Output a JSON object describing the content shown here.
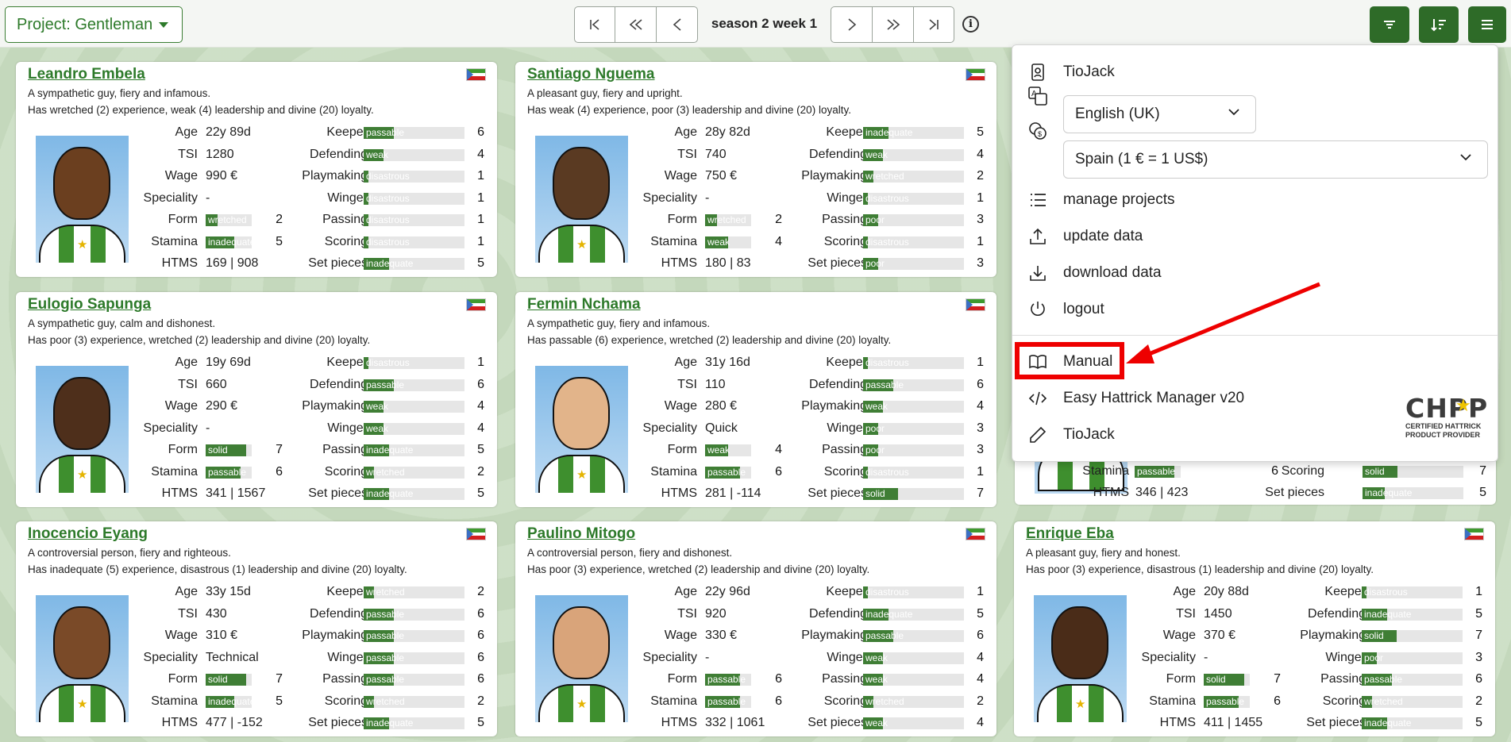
{
  "topbar": {
    "project_label": "Project: Gentleman",
    "season": "season 2 week 1",
    "info": "i"
  },
  "menu": {
    "user": "TioJack",
    "language": "English (UK)",
    "currency": "Spain (1 € = 1 US$)",
    "items": [
      "manage projects",
      "update data",
      "download data",
      "logout"
    ],
    "manual": "Manual",
    "app": "Easy Hattrick Manager v20",
    "author": "TioJack",
    "chpp_line1": "CERTIFIED HATTRICK",
    "chpp_line2": "PRODUCT PROVIDER",
    "chpp_logo": "CHPP"
  },
  "labels": {
    "age": "Age",
    "tsi": "TSI",
    "wage": "Wage",
    "speciality": "Speciality",
    "form": "Form",
    "stamina": "Stamina",
    "htms": "HTMS",
    "keeper": "Keeper",
    "defending": "Defending",
    "playmaking": "Playmaking",
    "winger": "Winger",
    "passing": "Passing",
    "scoring": "Scoring",
    "set_pieces": "Set pieces"
  },
  "players": [
    {
      "name": "Leandro Embela",
      "d1": "A sympathetic guy, fiery and infamous.",
      "d2": "Has wretched (2) experience, weak (4) leadership and divine (20) loyalty.",
      "age": "22y 89d",
      "tsi": "1280",
      "wage": "990 €",
      "spec": "-",
      "form": [
        "wretched",
        2
      ],
      "stamina": [
        "inadequate",
        5
      ],
      "htms": "169 | 908",
      "skills": [
        [
          "passable",
          6
        ],
        [
          "weak",
          4
        ],
        [
          "disastrous",
          1
        ],
        [
          "disastrous",
          1
        ],
        [
          "disastrous",
          1
        ],
        [
          "disastrous",
          1
        ],
        [
          "inadequate",
          5
        ]
      ],
      "skin": "#6b3f1f"
    },
    {
      "name": "Santiago Nguema",
      "d1": "A pleasant guy, fiery and upright.",
      "d2": "Has weak (4) experience, poor (3) leadership and divine (20) loyalty.",
      "age": "28y 82d",
      "tsi": "740",
      "wage": "750 €",
      "spec": "-",
      "form": [
        "wretched",
        2
      ],
      "stamina": [
        "weak",
        4
      ],
      "htms": "180 | 83",
      "skills": [
        [
          "inadequate",
          5
        ],
        [
          "weak",
          4
        ],
        [
          "wretched",
          2
        ],
        [
          "disastrous",
          1
        ],
        [
          "poor",
          3
        ],
        [
          "disastrous",
          1
        ],
        [
          "poor",
          3
        ]
      ],
      "skin": "#5a3a22"
    },
    {
      "name": "Eulogio Sapunga",
      "d1": "A sympathetic guy, calm and dishonest.",
      "d2": "Has poor (3) experience, wretched (2) leadership and divine (20) loyalty.",
      "age": "19y 69d",
      "tsi": "660",
      "wage": "290 €",
      "spec": "-",
      "form": [
        "solid",
        7
      ],
      "stamina": [
        "passable",
        6
      ],
      "htms": "341 | 1567",
      "skills": [
        [
          "disastrous",
          1
        ],
        [
          "passable",
          6
        ],
        [
          "weak",
          4
        ],
        [
          "weak",
          4
        ],
        [
          "inadequate",
          5
        ],
        [
          "wretched",
          2
        ],
        [
          "inadequate",
          5
        ]
      ],
      "skin": "#4e2f1b"
    },
    {
      "name": "Fermin Nchama",
      "d1": "A sympathetic guy, fiery and infamous.",
      "d2": "Has passable (6) experience, wretched (2) leadership and divine (20) loyalty.",
      "age": "31y 16d",
      "tsi": "110",
      "wage": "280 €",
      "spec": "Quick",
      "form": [
        "weak",
        4
      ],
      "stamina": [
        "passable",
        6
      ],
      "htms": "281 | -114",
      "skills": [
        [
          "disastrous",
          1
        ],
        [
          "passable",
          6
        ],
        [
          "weak",
          4
        ],
        [
          "poor",
          3
        ],
        [
          "poor",
          3
        ],
        [
          "disastrous",
          1
        ],
        [
          "solid",
          7
        ]
      ],
      "skin": "#e2b48a"
    },
    {
      "name": "Inocencio Eyang",
      "d1": "A controversial person, fiery and righteous.",
      "d2": "Has inadequate (5) experience, disastrous (1) leadership and divine (20) loyalty.",
      "age": "33y 15d",
      "tsi": "430",
      "wage": "310 €",
      "spec": "Technical",
      "form": [
        "solid",
        7
      ],
      "stamina": [
        "inadequate",
        5
      ],
      "htms": "477 | -152",
      "skills": [
        [
          "wretched",
          2
        ],
        [
          "passable",
          6
        ],
        [
          "passable",
          6
        ],
        [
          "passable",
          6
        ],
        [
          "passable",
          6
        ],
        [
          "wretched",
          2
        ],
        [
          "inadequate",
          5
        ]
      ],
      "skin": "#7a4a28"
    },
    {
      "name": "Paulino Mitogo",
      "d1": "A controversial person, fiery and dishonest.",
      "d2": "Has poor (3) experience, wretched (2) leadership and divine (20) loyalty.",
      "age": "22y 96d",
      "tsi": "920",
      "wage": "330 €",
      "spec": "-",
      "form": [
        "passable",
        6
      ],
      "stamina": [
        "passable",
        6
      ],
      "htms": "332 | 1061",
      "skills": [
        [
          "disastrous",
          1
        ],
        [
          "inadequate",
          5
        ],
        [
          "passable",
          6
        ],
        [
          "weak",
          4
        ],
        [
          "weak",
          4
        ],
        [
          "wretched",
          2
        ],
        [
          "weak",
          4
        ]
      ],
      "skin": "#d9a47a"
    },
    {
      "name": "Enrique Eba",
      "d1": "A pleasant guy, fiery and honest.",
      "d2": "Has poor (3) experience, disastrous (1) leadership and divine (20) loyalty.",
      "age": "20y 88d",
      "tsi": "1450",
      "wage": "370 €",
      "spec": "-",
      "form": [
        "solid",
        7
      ],
      "stamina": [
        "passable",
        6
      ],
      "htms": "411 | 1455",
      "skills": [
        [
          "disastrous",
          1
        ],
        [
          "inadequate",
          5
        ],
        [
          "solid",
          7
        ],
        [
          "poor",
          3
        ],
        [
          "passable",
          6
        ],
        [
          "wretched",
          2
        ],
        [
          "inadequate",
          5
        ]
      ],
      "skin": "#4a2c18"
    }
  ],
  "hidden_card": {
    "stamina": [
      "passable",
      6
    ],
    "scoring": [
      "solid",
      7
    ],
    "htms": "346 | 423",
    "setpieces": [
      "inadequate",
      5
    ]
  }
}
